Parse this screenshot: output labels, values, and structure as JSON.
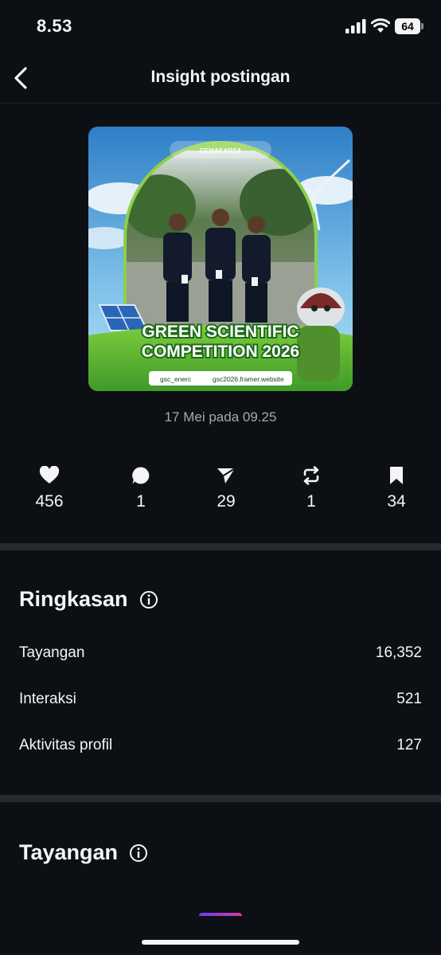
{
  "status_bar": {
    "time": "8.53",
    "battery": "64"
  },
  "header": {
    "title": "Insight postingan",
    "back_icon": "chevron-left-icon"
  },
  "post": {
    "image_text": {
      "headline_1": "GREEN SCIENTIFIC",
      "headline_2": "COMPETITION 2026",
      "logo_text": "GEMAKARSA",
      "footer_handle": "gsc_enerc",
      "footer_site": "gsc2026.framer.website"
    },
    "date": "17 Mei pada 09.25"
  },
  "metrics": [
    {
      "icon": "heart-icon",
      "value": "456"
    },
    {
      "icon": "comment-icon",
      "value": "1"
    },
    {
      "icon": "share-icon",
      "value": "29"
    },
    {
      "icon": "repost-icon",
      "value": "1"
    },
    {
      "icon": "bookmark-icon",
      "value": "34"
    }
  ],
  "summary": {
    "title": "Ringkasan",
    "rows": [
      {
        "label": "Tayangan",
        "value": "16,352"
      },
      {
        "label": "Interaksi",
        "value": "521"
      },
      {
        "label": "Aktivitas profil",
        "value": "127"
      }
    ]
  },
  "views_section": {
    "title": "Tayangan"
  },
  "colors": {
    "background": "#0c1014",
    "divider": "#262a2f",
    "text_primary": "#f5f5f5",
    "text_secondary": "#a8a8a8",
    "chart_gradient_start": "#6b3cf0",
    "chart_gradient_end": "#d63aa6"
  }
}
